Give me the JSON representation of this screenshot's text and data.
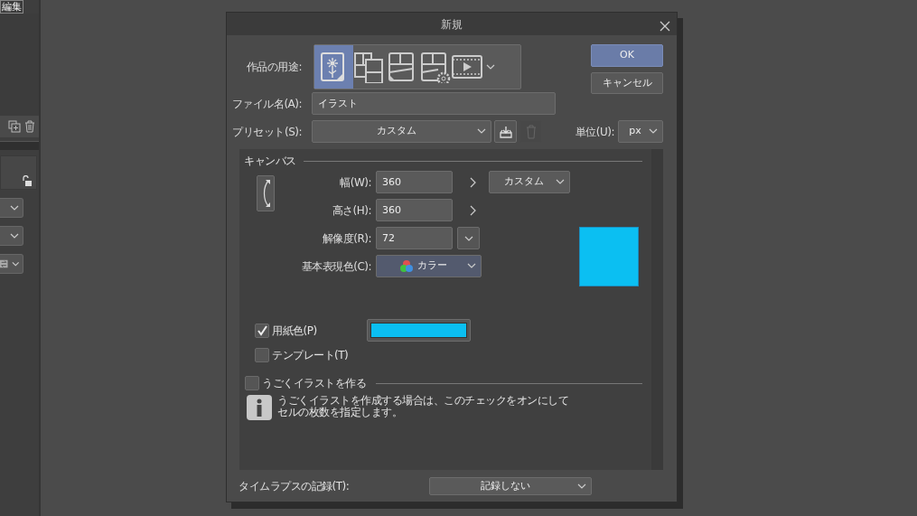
{
  "side_panel": {
    "tab": "編集"
  },
  "dialog": {
    "title": "新規",
    "purpose": {
      "label": "作品の用途:",
      "items": [
        {
          "kind": "illustration",
          "selected": true
        },
        {
          "kind": "comic",
          "selected": false
        },
        {
          "kind": "page",
          "selected": false
        },
        {
          "kind": "page_settings",
          "selected": false
        },
        {
          "kind": "animation",
          "selected": false
        }
      ]
    },
    "buttons": [
      {
        "label": "OK",
        "kind": "primary"
      },
      {
        "label": "キャンセル",
        "kind": "secondary"
      }
    ],
    "file_name": {
      "label": "ファイル名(A):",
      "value": "イラスト"
    },
    "preset": {
      "label": "プリセット(S):",
      "value": "カスタム"
    },
    "unit": {
      "label": "単位(U):",
      "value": "px"
    },
    "canvas": {
      "title": "キャンバス",
      "width": {
        "label": "幅(W):",
        "value": "360"
      },
      "height": {
        "label": "高さ(H):",
        "value": "360"
      },
      "size_preset": "カスタム",
      "resolution": {
        "label": "解像度(R):",
        "value": "72"
      },
      "color_mode": {
        "label": "基本表現色(C):",
        "value": "カラー"
      },
      "paper_color": {
        "label": "用紙色(P)",
        "checked": true,
        "color": "#0bbff2"
      },
      "template": {
        "label": "テンプレート(T)",
        "checked": false
      }
    },
    "animation": {
      "label": "うごくイラストを作る",
      "checked": false,
      "info": [
        "うごくイラストを作成する場合は、このチェックをオンにして",
        "セルの枚数を指定します。"
      ]
    },
    "timelapse": {
      "label": "タイムラプスの記録(T):",
      "value": "記録しない"
    }
  }
}
